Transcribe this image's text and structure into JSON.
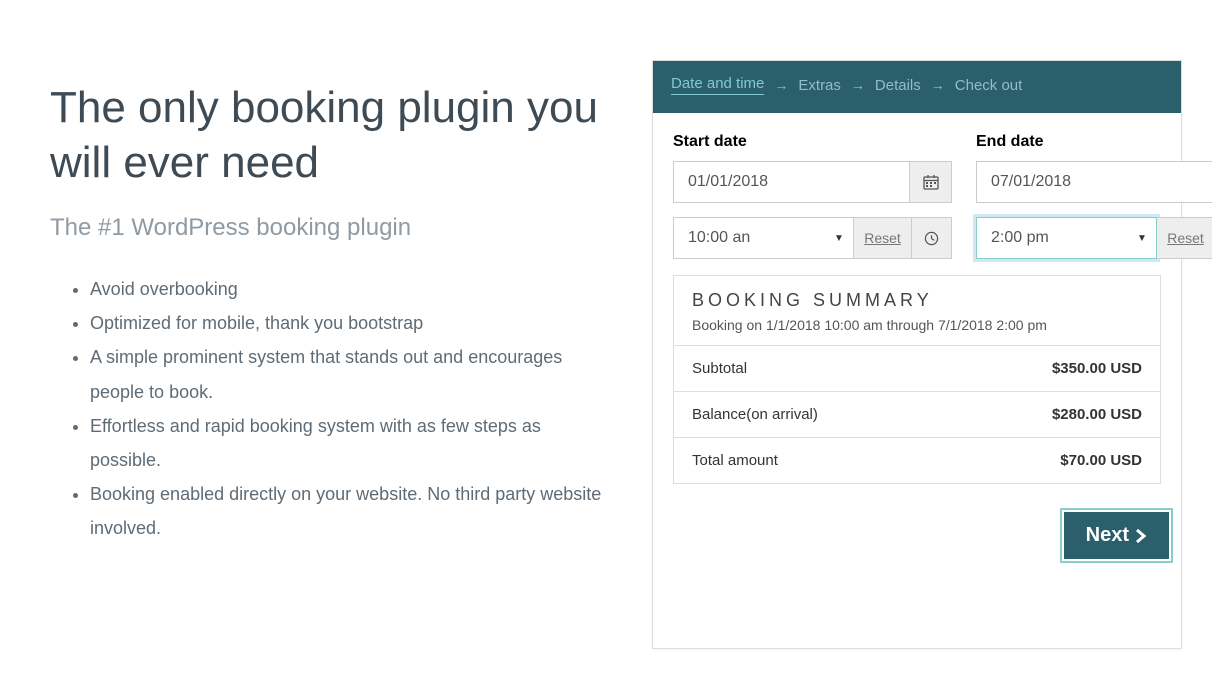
{
  "hero": {
    "title": "The only booking plugin you will ever need",
    "subtitle": "The #1 WordPress booking plugin",
    "bullets": [
      "Avoid overbooking",
      "Optimized for mobile, thank you bootstrap",
      "A simple prominent system that stands out and encourages people to book.",
      "Effortless and rapid booking system with as few steps as possible.",
      "Booking enabled directly on your website. No third party website involved."
    ]
  },
  "steps": {
    "items": [
      "Date and time",
      "Extras",
      "Details",
      "Check out"
    ],
    "active_index": 0
  },
  "form": {
    "start_label": "Start date",
    "end_label": "End date",
    "start_date": "01/01/2018",
    "end_date": "07/01/2018",
    "start_time": "10:00 an",
    "end_time": "2:00 pm",
    "reset_label": "Reset"
  },
  "summary": {
    "title": "BOOKING SUMMARY",
    "subtitle": "Booking on 1/1/2018 10:00 am through 7/1/2018 2:00 pm",
    "rows": [
      {
        "label": "Subtotal",
        "amount": "$350.00 USD"
      },
      {
        "label": "Balance(on arrival)",
        "amount": "$280.00 USD"
      },
      {
        "label": "Total amount",
        "amount": "$70.00 USD"
      }
    ]
  },
  "next_label": "Next"
}
